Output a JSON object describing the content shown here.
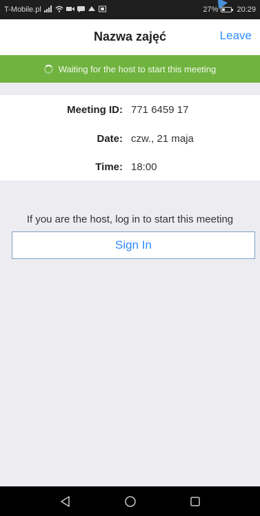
{
  "status_bar": {
    "carrier": "T-Mobile.pl",
    "battery": "27%",
    "battery_level": 0.27,
    "time": "20:29",
    "icons": [
      "signal-icon",
      "wifi-icon",
      "video-icon",
      "message-icon",
      "cloud-icon",
      "sim-icon"
    ]
  },
  "header": {
    "title": "Nazwa zajęć",
    "leave_label": "Leave"
  },
  "banner": {
    "text": "Waiting for the host to start this meeting",
    "color": "#70b33f"
  },
  "details": {
    "meeting_id_label": "Meeting ID:",
    "meeting_id_value": "771 6459 17",
    "date_label": "Date:",
    "date_value": "czw., 21 maja",
    "time_label": "Time:",
    "time_value": "18:00"
  },
  "host": {
    "hint": "If you are the host, log in to start this meeting",
    "sign_in_label": "Sign In"
  },
  "colors": {
    "accent": "#2d8cff",
    "background": "#ededf1"
  },
  "android_nav": {
    "icons": [
      "back-icon",
      "home-icon",
      "recents-icon"
    ]
  }
}
